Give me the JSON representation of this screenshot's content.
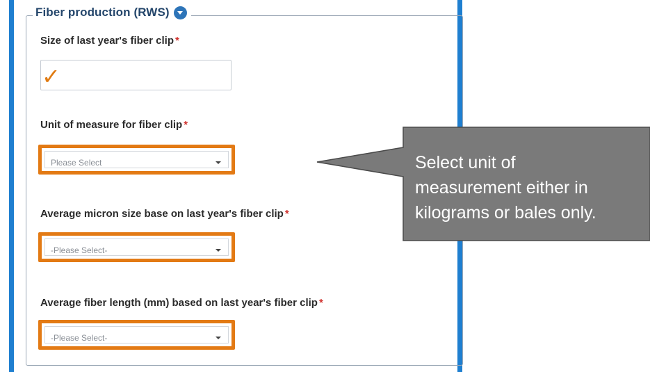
{
  "section": {
    "title": "Fiber production (RWS)",
    "toggle_icon": "chevron-down-circle-icon"
  },
  "fields": {
    "clip_size": {
      "label": "Size of last year's fiber clip",
      "required_mark": "*",
      "value": "",
      "annotation_icon": "checkmark-icon",
      "annotation_glyph": "✓"
    },
    "unit": {
      "label": "Unit of measure for fiber clip",
      "required_mark": "*",
      "selected": "Please Select"
    },
    "micron": {
      "label": "Average micron size base on last year's fiber clip",
      "required_mark": "*",
      "selected": "-Please Select-"
    },
    "length": {
      "label": "Average fiber length (mm) based on last year's fiber clip",
      "required_mark": "*",
      "selected": "-Please Select-"
    }
  },
  "callout": {
    "text_line1": "Select unit of",
    "text_line2": "measurement either in",
    "text_line3": "kilograms or bales only."
  },
  "colors": {
    "highlight": "#e37a14",
    "accent_bar": "#1f7fd0",
    "callout_fill": "#7a7a7a",
    "required": "#d0312d"
  }
}
